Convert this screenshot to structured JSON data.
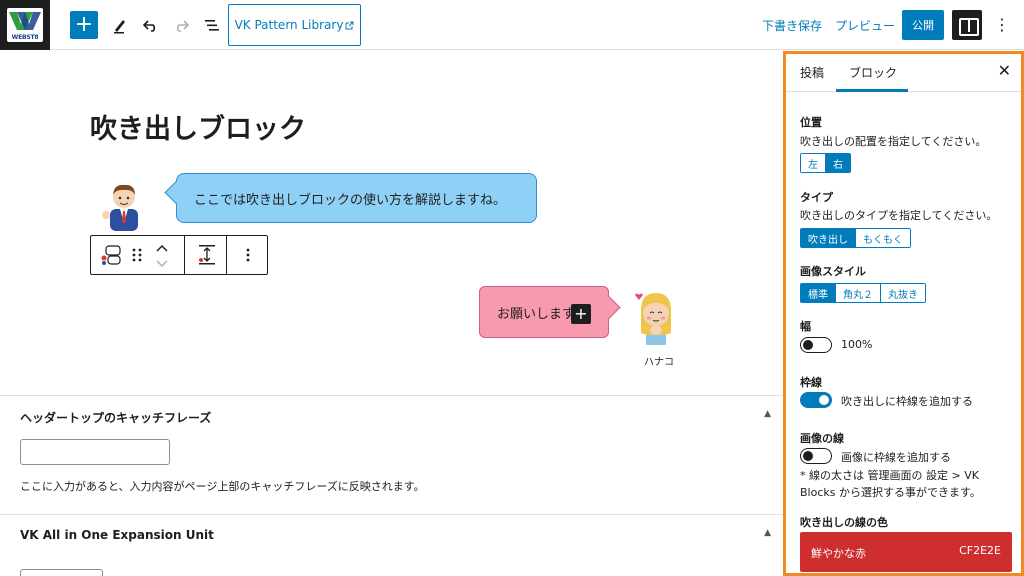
{
  "topbar": {
    "logo_text": "WEBST8",
    "pattern_library": "VK Pattern Library",
    "save_draft": "下書き保存",
    "preview": "プレビュー",
    "publish": "公開",
    "more": "⋮"
  },
  "editor": {
    "title": "吹き出しブロック",
    "bubble_left_text": "ここでは吹き出しブロックの使い方を解説しますね。",
    "bubble_right_text": "お願いします",
    "bubble_right_name": "ハナコ"
  },
  "meta": {
    "catchphrase_heading": "ヘッダートップのキャッチフレーズ",
    "catchphrase_help": "ここに入力があると、入力内容がページ上部のキャッチフレーズに反映されます。",
    "expansion_heading": "VK All in One Expansion Unit",
    "toggle_glyph": "▲"
  },
  "sidebar": {
    "tab_post": "投稿",
    "tab_block": "ブロック",
    "close": "✕",
    "position_label": "位置",
    "position_help": "吹き出しの配置を指定してください。",
    "position_options": [
      "左",
      "右"
    ],
    "type_label": "タイプ",
    "type_help": "吹き出しのタイプを指定してください。",
    "type_options": [
      "吹き出し",
      "もくもく"
    ],
    "image_style_label": "画像スタイル",
    "image_style_options": [
      "標準",
      "角丸２",
      "丸抜き"
    ],
    "width_label": "幅",
    "width_value": "100%",
    "border_label": "枠線",
    "border_toggle_label": "吹き出しに枠線を追加する",
    "image_border_label": "画像の線",
    "image_border_toggle_label": "画像に枠線を追加する",
    "image_border_help": "* 線の太さは 管理画面の 設定 > VK Blocks から選択する事ができます。",
    "bubble_color_label": "吹き出しの線の色",
    "color_name": "鮮やかな赤",
    "color_hex": "CF2E2E"
  },
  "colors": {
    "accent": "#007cba",
    "highlight": "#f08a24",
    "bubble_left": "#8fd0f6",
    "bubble_right": "#f89aaf",
    "vivid_red": "#cf2e2e"
  },
  "icons": {
    "add": "plus-icon",
    "pen": "pen-icon",
    "undo": "undo-icon",
    "redo": "redo-icon",
    "outline": "list-view-icon",
    "external": "external-link-icon",
    "settings": "settings-panel-icon",
    "drag": "drag-handle-icon",
    "move": "chevron-up-down-icon",
    "align": "vertical-align-icon",
    "options": "more-options-icon"
  }
}
